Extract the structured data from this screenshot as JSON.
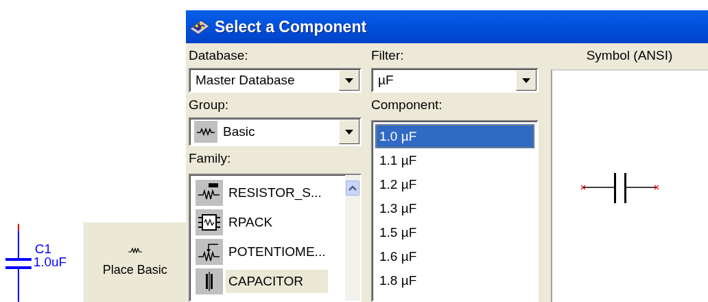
{
  "schematic": {
    "ref": "C1",
    "value": "1.0uF"
  },
  "toolbar_button": {
    "label": "Place Basic"
  },
  "window": {
    "title": "Select a Component"
  },
  "database": {
    "label": "Database:",
    "value": "Master Database"
  },
  "group": {
    "label": "Group:",
    "value": "Basic"
  },
  "family": {
    "label": "Family:",
    "items": [
      {
        "label": "RESISTOR_S...",
        "kind": "resistor",
        "selected": false
      },
      {
        "label": "RPACK",
        "kind": "rpack",
        "selected": false
      },
      {
        "label": "POTENTIOME...",
        "kind": "potentiometer",
        "selected": false
      },
      {
        "label": "CAPACITOR",
        "kind": "capacitor",
        "selected": true
      }
    ]
  },
  "filter": {
    "label": "Filter:",
    "value": "µF"
  },
  "component": {
    "label": "Component:",
    "items": [
      {
        "label": "1.0 µF",
        "selected": true
      },
      {
        "label": "1.1 µF",
        "selected": false
      },
      {
        "label": "1.2 µF",
        "selected": false
      },
      {
        "label": "1.3 µF",
        "selected": false
      },
      {
        "label": "1.5 µF",
        "selected": false
      },
      {
        "label": "1.6 µF",
        "selected": false
      },
      {
        "label": "1.8 µF",
        "selected": false
      }
    ]
  },
  "symbol": {
    "label": "Symbol (ANSI)"
  }
}
